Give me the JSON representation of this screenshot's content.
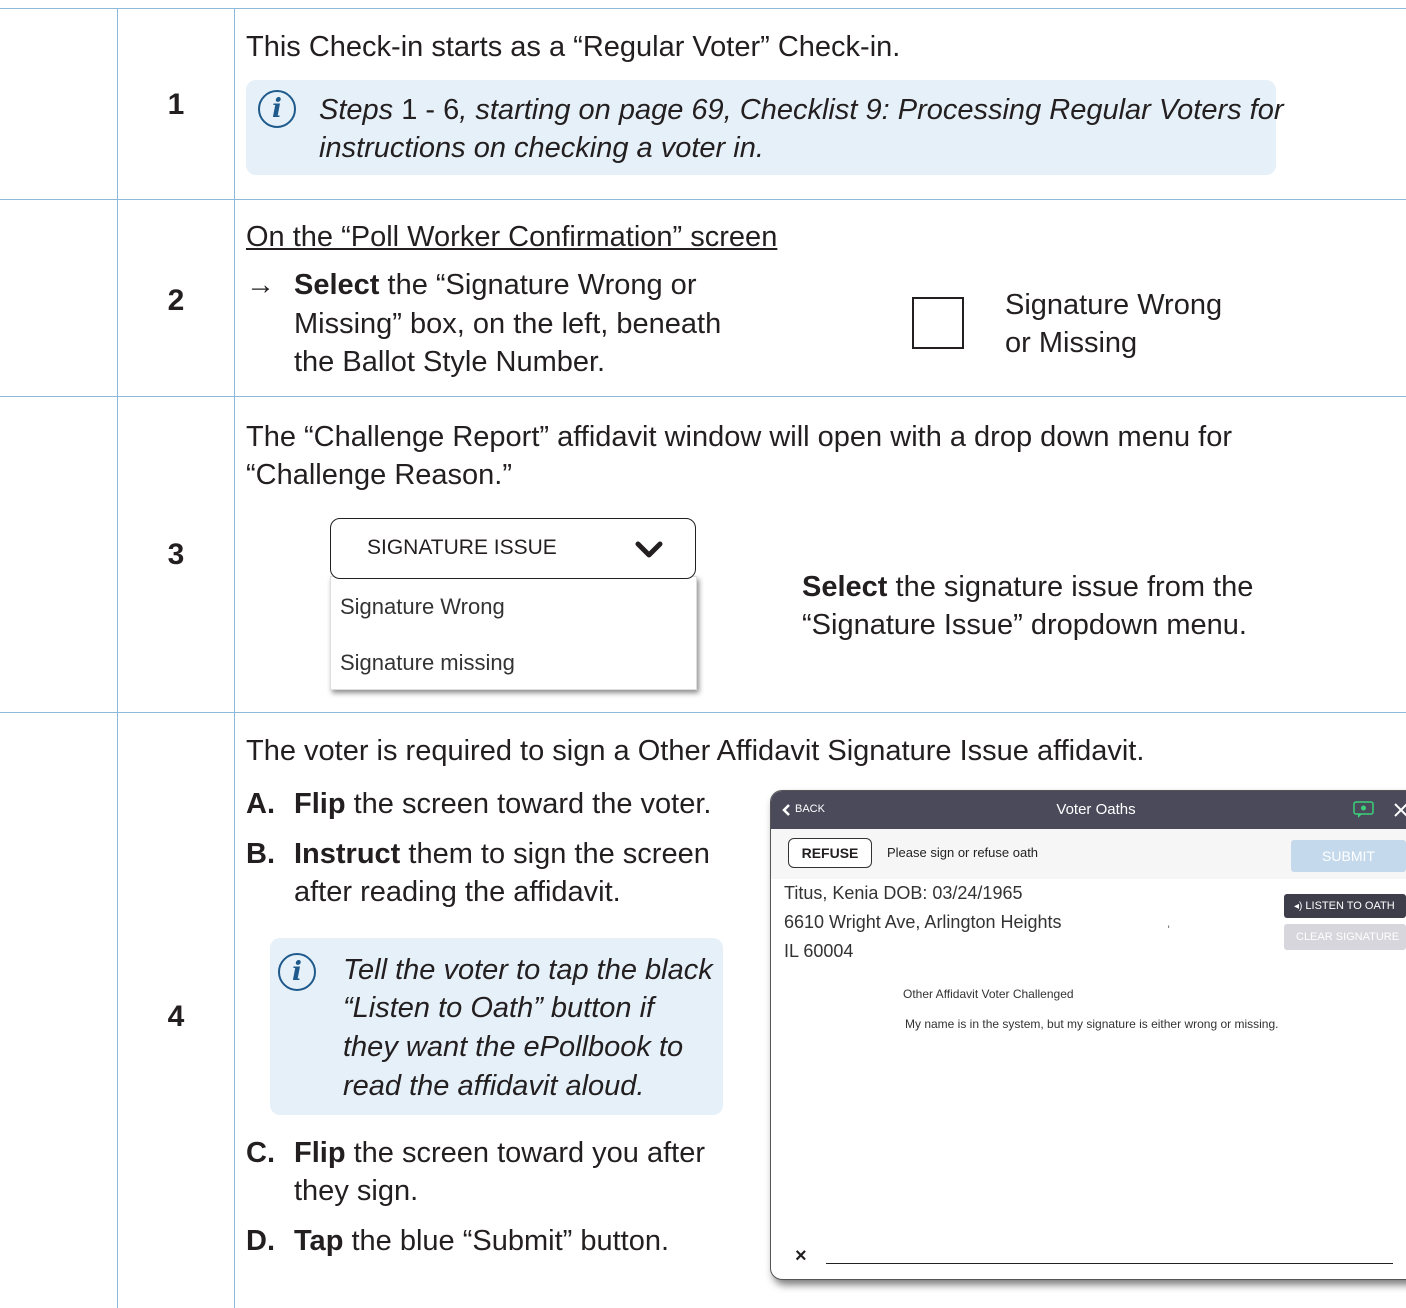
{
  "steps": [
    {
      "number": "1"
    },
    {
      "number": "2"
    },
    {
      "number": "3"
    },
    {
      "number": "4"
    }
  ],
  "step1": {
    "text": "This Check-in starts as a “Regular Voter” Check-in.",
    "note_a": "Steps",
    "note_b": " 1 - 6",
    "note_c": ", starting on page 69, Checklist 9: Processing Regular Voters for",
    "note_d": "instructions on checking a voter in."
  },
  "step2": {
    "heading": "On the “Poll Worker Confirmation” screen",
    "arrow": "→",
    "select_bold": "Select",
    "line1_rest": " the “Signature Wrong or",
    "line2": "Missing” box, on the left, beneath",
    "line3": "the Ballot Style Number.",
    "checkbox_label_1": "Signature Wrong",
    "checkbox_label_2": "or Missing"
  },
  "step3": {
    "line1": "The “Challenge Report” affidavit window will open with a drop down menu for",
    "line2": "“Challenge Reason.”",
    "dropdown_value": "SIGNATURE ISSUE",
    "dropdown_options": [
      "Signature Wrong",
      "Signature missing"
    ],
    "select_bold": "Select",
    "right_line1_rest": " the signature issue from the",
    "right_line2": "“Signature Issue” dropdown menu."
  },
  "step4": {
    "intro": "The voter is required to sign a Other Affidavit Signature Issue affidavit.",
    "a_label": "A.",
    "a_bold": "Flip",
    "a_rest": " the screen toward the voter.",
    "b_label": "B.",
    "b_bold": "Instruct",
    "b_rest": " them to sign the screen",
    "b_line2": "after reading the affidavit.",
    "note_lines": [
      "Tell the voter to tap the black",
      "“Listen to Oath” button if",
      "they want the ePollbook to",
      "read the affidavit aloud."
    ],
    "c_label": "C.",
    "c_bold": "Flip",
    "c_rest": " the screen toward you after",
    "c_line2": "they sign.",
    "d_label": "D.",
    "d_bold": "Tap",
    "d_rest": " the blue “Submit” button."
  },
  "tablet": {
    "back_label": "BACK",
    "title": "Voter Oaths",
    "refuse_label": "REFUSE",
    "prompt": "Please sign or refuse oath",
    "submit_label": "SUBMIT",
    "voter_line1": "Titus, Kenia DOB: 03/24/1965",
    "voter_line2": "6610 Wright Ave, Arlington Heights",
    "voter_line3": "IL 60004",
    "stray_mark": "ˌ",
    "listen_label": "LISTEN TO OATH",
    "clear_label": "CLEAR SIGNATURE",
    "oath_title": "Other Affidavit Voter Challenged",
    "oath_text": "My name is in the system, but my signature is either wrong or missing.",
    "sign_x": "×"
  },
  "colors": {
    "rule": "#8fb9d9",
    "note_bg": "#e6f0f8",
    "info_blue": "#1e5a8c",
    "tablet_header": "#4b4a5b",
    "submit_disabled": "#c5d9ec"
  },
  "icons": {
    "info": "i",
    "chevron": "chevron-down-icon",
    "back": "chevron-left-icon",
    "chat": "chat-icon",
    "close": "close-icon",
    "speaker": "speaker-icon"
  }
}
